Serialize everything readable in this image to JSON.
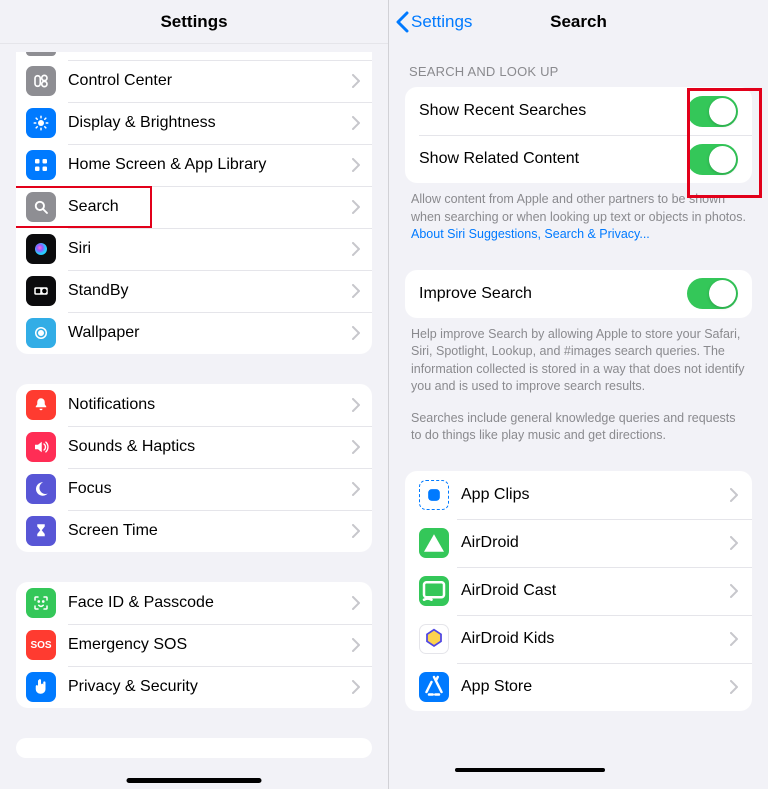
{
  "left": {
    "title": "Settings",
    "group1": [
      {
        "label": "Control Center",
        "icon": "controls-icon",
        "bg": "bg-gray"
      },
      {
        "label": "Display & Brightness",
        "icon": "brightness-icon",
        "bg": "bg-blue"
      },
      {
        "label": "Home Screen & App Library",
        "icon": "grid-icon",
        "bg": "bg-blue"
      },
      {
        "label": "Search",
        "icon": "search-icon",
        "bg": "bg-gray"
      },
      {
        "label": "Siri",
        "icon": "siri-icon",
        "bg": "bg-black"
      },
      {
        "label": "StandBy",
        "icon": "standby-icon",
        "bg": "bg-black"
      },
      {
        "label": "Wallpaper",
        "icon": "wallpaper-icon",
        "bg": "bg-cyan"
      }
    ],
    "group2": [
      {
        "label": "Notifications",
        "icon": "bell-icon",
        "bg": "bg-red"
      },
      {
        "label": "Sounds & Haptics",
        "icon": "speaker-icon",
        "bg": "bg-redpink"
      },
      {
        "label": "Focus",
        "icon": "moon-icon",
        "bg": "bg-purple"
      },
      {
        "label": "Screen Time",
        "icon": "hourglass-icon",
        "bg": "bg-purple"
      }
    ],
    "group3": [
      {
        "label": "Face ID & Passcode",
        "icon": "face-icon",
        "bg": "bg-green"
      },
      {
        "label": "Emergency SOS",
        "icon": "sos-icon",
        "bg": "bg-red",
        "text": "SOS"
      },
      {
        "label": "Privacy & Security",
        "icon": "hand-icon",
        "bg": "bg-blue"
      }
    ]
  },
  "right": {
    "back": "Settings",
    "title": "Search",
    "section1_hdr": "SEARCH AND LOOK UP",
    "section1": [
      {
        "label": "Show Recent Searches",
        "on": true
      },
      {
        "label": "Show Related Content",
        "on": true
      }
    ],
    "footer1": "Allow content from Apple and other partners to be shown when searching or when looking up text or objects in photos. ",
    "footer1_link": "About Siri Suggestions, Search & Privacy...",
    "section2": [
      {
        "label": "Improve Search",
        "on": true
      }
    ],
    "footer2": "Help improve Search by allowing Apple to store your Safari, Siri, Spotlight, Lookup, and #images search queries. The information collected is stored in a way that does not identify you and is used to improve search results.",
    "footer3": "Searches include general knowledge queries and requests to do things like play music and get directions.",
    "apps": [
      {
        "label": "App Clips",
        "icon": "appclips-icon",
        "bg": "bg-border-blue"
      },
      {
        "label": "AirDroid",
        "icon": "airdroid-icon",
        "bg": "bg-green"
      },
      {
        "label": "AirDroid Cast",
        "icon": "airdroidcast-icon",
        "bg": "bg-green"
      },
      {
        "label": "AirDroid Kids",
        "icon": "airdroidkids-icon",
        "bg": ""
      },
      {
        "label": "App Store",
        "icon": "appstore-icon",
        "bg": "bg-blue"
      }
    ]
  }
}
